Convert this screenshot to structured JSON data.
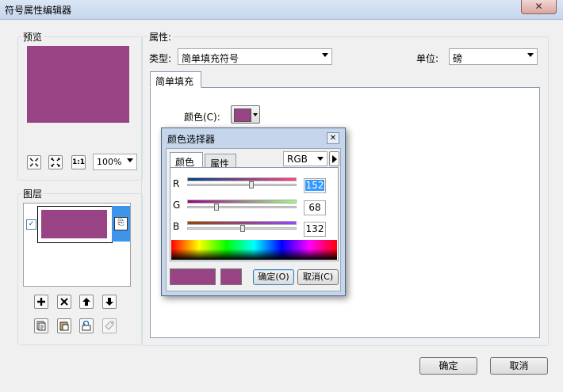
{
  "window": {
    "title": "符号属性编辑器",
    "close_label": "✕"
  },
  "preview": {
    "label": "预览",
    "zoom_value": "100%",
    "swatch_color": "#984484"
  },
  "layers": {
    "label": "图层",
    "checked": true
  },
  "properties": {
    "label": "属性:",
    "type_label": "类型:",
    "type_value": "简单填充符号",
    "unit_label": "单位:",
    "unit_value": "磅",
    "tab_label": "简单填充",
    "color_label": "颜色(C):"
  },
  "color_picker": {
    "title": "颜色选择器",
    "tabs": [
      "颜色",
      "属性"
    ],
    "mode": "RGB",
    "r_label": "R",
    "g_label": "G",
    "b_label": "B",
    "r_value": "152",
    "g_value": "68",
    "b_value": "132",
    "ok_label": "确定(O)",
    "cancel_label": "取消(C)",
    "close_label": "✕",
    "current_color": "#984484",
    "original_color": "#984484"
  },
  "footer": {
    "ok_label": "确定",
    "cancel_label": "取消"
  }
}
